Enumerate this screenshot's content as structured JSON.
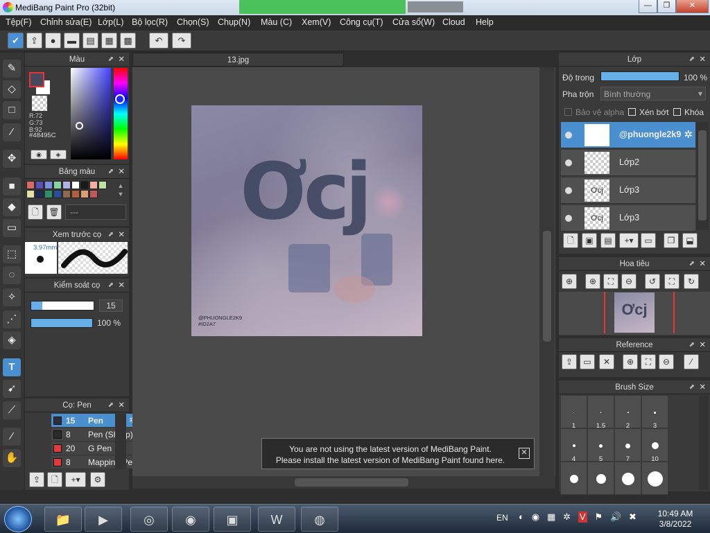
{
  "window": {
    "title": "MediBang Paint Pro (32bit)",
    "minimize": "—",
    "maximize": "❐",
    "close": "✕"
  },
  "menu": [
    "Tệp(F)",
    "Chỉnh sửa(E)",
    "Lớp(L)",
    "Bộ lọc(R)",
    "Chọn(S)",
    "Chụp(N)",
    "Màu (C)",
    "Xem(V)",
    "Công cụ(T)",
    "Cửa sổ(W)",
    "Cloud",
    "Help"
  ],
  "color_panel": {
    "title": "Màu",
    "rgb_r": "R:72",
    "rgb_g": "G:73",
    "rgb_b": "B:92",
    "hex": "#48495C",
    "fg": "#48495C"
  },
  "palette_panel": {
    "title": "Bảng màu",
    "colors": [
      "#d96a6a",
      "#5a4fb3",
      "#7b8fe0",
      "#88d4a0",
      "#b1b3e8",
      "#ffffff",
      "#1a1a1a",
      "#f2b0a0",
      "#bde3a0",
      "#e0e0a8",
      "#1d2a55",
      "#2f8f6a",
      "#2d4f9a",
      "#8a6a4a",
      "#b06040",
      "#d9a070",
      "#c05a5a"
    ],
    "empty": "---"
  },
  "brush_preview": {
    "title": "Xem trước cọ",
    "size": "3.97mm"
  },
  "brush_control": {
    "title": "Kiểm soát cọ",
    "size_value": "15",
    "opacity_value": "100 %",
    "size_level": 0.18,
    "opacity_level": 1.0
  },
  "brush_panel": {
    "title": "Cọ: Pen",
    "items": [
      {
        "color": "#2b2f3a",
        "size": "15",
        "name": "Pen",
        "selected": true
      },
      {
        "color": "#2b2b2b",
        "size": "8",
        "name": "Pen (Sharp)",
        "selected": false
      },
      {
        "color": "#e23b3b",
        "size": "20",
        "name": "G Pen",
        "selected": false
      },
      {
        "color": "#e23b3b",
        "size": "8",
        "name": "Mapping Pen",
        "selected": false
      }
    ]
  },
  "document": {
    "tab": "13.jpg",
    "art_text": "Ơcj",
    "watermark_1": "@PHUONGLE2K9",
    "watermark_2": "#ID2A7"
  },
  "notification": {
    "line1": "You are not using the latest version of MediBang Paint.",
    "line2": "Please install the latest version of MediBang Paint found here.",
    "close": "✕"
  },
  "layer_panel": {
    "title": "Lớp",
    "opacity_label": "Độ trong",
    "opacity_value": "100 %",
    "opacity_level": 1.0,
    "blend_label": "Pha trộn",
    "blend_value": "Bình thường",
    "protect_alpha": "Bảo vệ alpha",
    "clipping": "Xén bớt",
    "lock": "Khóa",
    "layers": [
      {
        "name": "@phuongle2k9",
        "thumb": "",
        "selected": true
      },
      {
        "name": "Lớp2",
        "thumb": "",
        "selected": false
      },
      {
        "name": "Lớp3",
        "thumb": "Ơcj",
        "selected": false
      },
      {
        "name": "Lớp3",
        "thumb": "Ơcj",
        "selected": false
      }
    ]
  },
  "navigator": {
    "title": "Hoa tiêu",
    "thumb_text": "Ơcj"
  },
  "reference": {
    "title": "Reference"
  },
  "brush_size": {
    "title": "Brush Size",
    "labels": [
      "1",
      "1.5",
      "2",
      "3",
      "4",
      "5",
      "7",
      "10",
      "",
      "",
      "",
      ""
    ]
  },
  "taskbar": {
    "lang": "EN",
    "time": "10:49 AM",
    "date": "3/8/2022"
  }
}
